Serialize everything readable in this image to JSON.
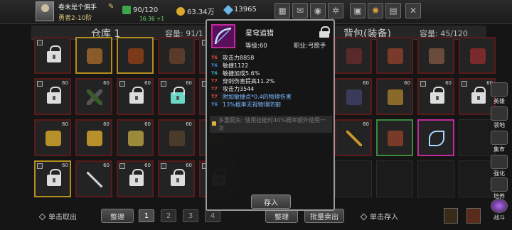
{
  "player": {
    "name": "卷末是个佣手",
    "title": "勇者2-10阶"
  },
  "resources": {
    "stamina": "90/120",
    "stamina_timer": "16:36 +1",
    "gold": "63.34万",
    "gems": "13965"
  },
  "warehouse": {
    "title": "仓库 1",
    "capacity": "容量: 91/1"
  },
  "backpack": {
    "title": "背包(装备)",
    "capacity": "容量: 45/120"
  },
  "slot_level": "60",
  "tooltip": {
    "name": "星穹追猎",
    "level": "等级:60",
    "job": "职业:弓箭手",
    "stats": [
      {
        "tag": "T6",
        "text": "攻击力8858",
        "tag_color": "r",
        "blue": false
      },
      {
        "tag": "T6",
        "text": "敏捷1122",
        "tag_color": "r",
        "blue": false
      },
      {
        "tag": "T6",
        "text": "敏捷加成5.6%",
        "tag_color": "c",
        "blue": false
      },
      {
        "tag": "T7",
        "text": "穿刺伤害提高11.2%",
        "tag_color": "r",
        "blue": false
      },
      {
        "tag": "T7",
        "text": "攻击力3544",
        "tag_color": "r",
        "blue": false
      },
      {
        "tag": "T7",
        "text": "附加敏捷点*0.4的物理伤害",
        "tag_color": "r",
        "blue": true
      },
      {
        "tag": "T6",
        "text": "13%概率无视物理防御",
        "tag_color": "b",
        "blue": true
      }
    ],
    "locked_text": "多重箭矢: 使用技能时40%概率额外使用一次",
    "store_button": "存入"
  },
  "bottom_left": {
    "hint": "单击取出",
    "sort_button": "整理",
    "pages": [
      "1",
      "2",
      "3",
      "4"
    ]
  },
  "bottom_right": {
    "sort_button": "整理",
    "bulk_sell_button": "批量卖出",
    "hint": "单击存入"
  },
  "side_menu": [
    "英雄",
    "领地",
    "集市",
    "强化",
    "培养",
    "战斗"
  ],
  "colors": {
    "rare_border": "#5a1a1a",
    "legend_border": "#b58d1e",
    "epic_border": "#c02a9a",
    "uncommon_border": "#3c8a3c"
  }
}
